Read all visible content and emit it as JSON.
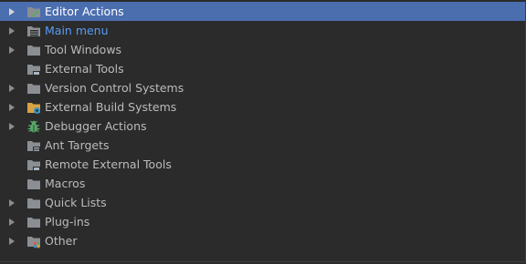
{
  "tree": {
    "items": [
      {
        "label": "Editor Actions",
        "icon": "editor-folder-icon",
        "expandable": true,
        "selected": true
      },
      {
        "label": "Main menu",
        "icon": "menu-folder-icon",
        "expandable": true,
        "selected": false
      },
      {
        "label": "Tool Windows",
        "icon": "folder-icon",
        "expandable": true,
        "selected": false
      },
      {
        "label": "External Tools",
        "icon": "tools-folder-icon",
        "expandable": false,
        "selected": false
      },
      {
        "label": "Version Control Systems",
        "icon": "folder-icon",
        "expandable": true,
        "selected": false
      },
      {
        "label": "External Build Systems",
        "icon": "build-folder-icon",
        "expandable": true,
        "selected": false
      },
      {
        "label": "Debugger Actions",
        "icon": "bug-icon",
        "expandable": true,
        "selected": false
      },
      {
        "label": "Ant Targets",
        "icon": "ant-folder-icon",
        "expandable": false,
        "selected": false
      },
      {
        "label": "Remote External Tools",
        "icon": "tools-folder-icon",
        "expandable": false,
        "selected": false
      },
      {
        "label": "Macros",
        "icon": "folder-icon",
        "expandable": false,
        "selected": false
      },
      {
        "label": "Quick Lists",
        "icon": "folder-icon",
        "expandable": true,
        "selected": false
      },
      {
        "label": "Plug-ins",
        "icon": "folder-icon",
        "expandable": true,
        "selected": false
      },
      {
        "label": "Other",
        "icon": "other-folder-icon",
        "expandable": true,
        "selected": false
      }
    ]
  },
  "colors": {
    "background": "#2b2b2b",
    "selection": "#4b6eaf",
    "text": "#bbbbbb",
    "link": "#589df6",
    "folder": "#8b8f93"
  }
}
